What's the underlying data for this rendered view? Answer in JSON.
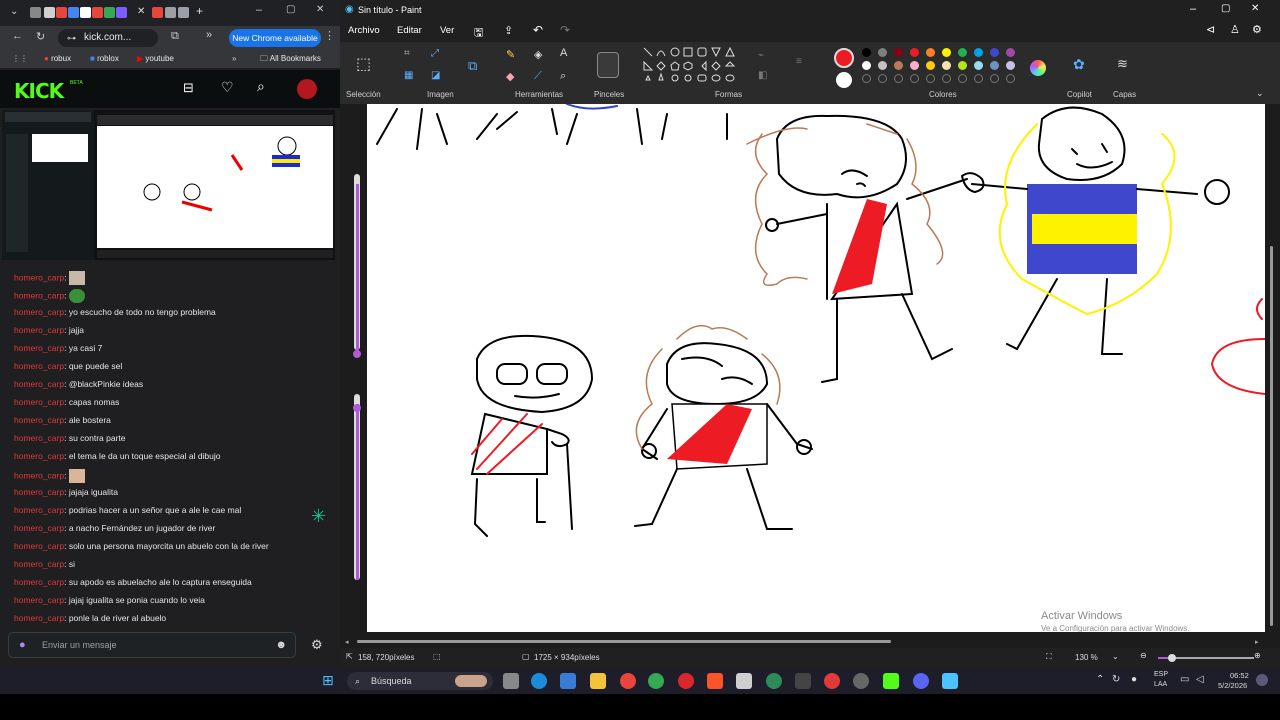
{
  "browser": {
    "url": "kick.com...",
    "new_chrome": "New Chrome available",
    "bookmarks": [
      "robux",
      "roblox",
      "youtube"
    ],
    "all_bookmarks": "All Bookmarks"
  },
  "kick": {
    "logo": "KICK",
    "beta": "BETA"
  },
  "chat": {
    "messages": [
      {
        "user": "homero_carp",
        "text": ":"
      },
      {
        "user": "homero_carp",
        "text": ":"
      },
      {
        "user": "homero_carp",
        "text": ": yo escucho de todo no tengo problema"
      },
      {
        "user": "homero_carp",
        "text": ": jajja"
      },
      {
        "user": "homero_carp",
        "text": ": ya casi 7"
      },
      {
        "user": "homero_carp",
        "text": ": que puede sel"
      },
      {
        "user": "homero_carp",
        "text": ": @blackPinkie ideas"
      },
      {
        "user": "homero_carp",
        "text": ": capas nomas"
      },
      {
        "user": "homero_carp",
        "text": ": ale bostera"
      },
      {
        "user": "homero_carp",
        "text": ": su contra parte"
      },
      {
        "user": "homero_carp",
        "text": ": el tema le da un toque especial al dibujo"
      },
      {
        "user": "homero_carp",
        "text": ":"
      },
      {
        "user": "homero_carp",
        "text": ": jajaja igualita"
      },
      {
        "user": "homero_carp",
        "text": ": podrias hacer a un señor que a ale le cae mal"
      },
      {
        "user": "homero_carp",
        "text": ": a nacho Fernández un jugador de river"
      },
      {
        "user": "homero_carp",
        "text": ": solo una persona mayorcita un abuelo con la de river"
      },
      {
        "user": "homero_carp",
        "text": ": si"
      },
      {
        "user": "homero_carp",
        "text": ": su apodo es abuelacho ale lo captura enseguida"
      },
      {
        "user": "homero_carp",
        "text": ": jajaj igualita se ponia cuando lo veia"
      },
      {
        "user": "homero_carp",
        "text": ": ponle la de river al abuelo"
      }
    ],
    "input_placeholder": "Enviar un mensaje"
  },
  "paint": {
    "title": "Sin título - Paint",
    "menu": [
      "Archivo",
      "Editar",
      "Ver"
    ],
    "groups": {
      "seleccion": "Selección",
      "imagen": "Imagen",
      "herramientas": "Herramientas",
      "pinceles": "Pinceles",
      "formas": "Formas",
      "colores": "Colores",
      "copilot": "Copilot",
      "capas": "Capas"
    },
    "status": {
      "cursor": "158, 720píxeles",
      "size": "1725 × 934píxeles",
      "zoom": "130 %"
    },
    "watermark_title": "Activar Windows",
    "watermark_sub": "Ve a Configuración para activar Windows.",
    "palette": [
      "#000000",
      "#7f7f7f",
      "#880015",
      "#ed1c24",
      "#ff7f27",
      "#fff200",
      "#22b14c",
      "#00a2e8",
      "#3f48cc",
      "#a349a4",
      "#ffffff",
      "#c3c3c3",
      "#b97a57",
      "#ffaec9",
      "#ffc90e",
      "#efe4b0",
      "#b5e61d",
      "#99d9ea",
      "#7092be",
      "#c8bfe7"
    ]
  },
  "taskbar": {
    "search": "Búsqueda",
    "lang": "ESP",
    "lang2": "LAA",
    "time": "06:52",
    "date": "5/2/2026"
  }
}
